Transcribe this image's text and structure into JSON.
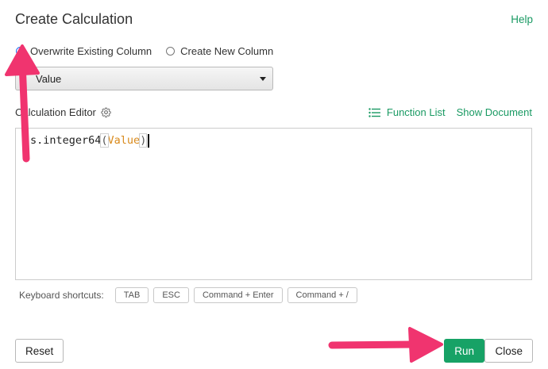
{
  "dialog": {
    "title": "Create Calculation",
    "help_label": "Help"
  },
  "mode": {
    "options": [
      {
        "label": "Overwrite Existing Column",
        "checked": true
      },
      {
        "label": "Create New Column",
        "checked": false
      }
    ]
  },
  "column_select": {
    "value": "Value"
  },
  "editor": {
    "label": "Calculation Editor",
    "function_list_label": "Function List",
    "show_document_label": "Show Document",
    "code_prefix": "s.integer64",
    "code_open": "(",
    "code_arg": "Value",
    "code_close": ")"
  },
  "shortcuts": {
    "label": "Keyboard shortcuts:",
    "keys": [
      "TAB",
      "ESC",
      "Command + Enter",
      "Command + /"
    ]
  },
  "footer": {
    "reset_label": "Reset",
    "run_label": "Run",
    "close_label": "Close"
  },
  "colors": {
    "accent_green": "#17a266",
    "link_green": "#1a9a63",
    "radio_blue": "#1d6ef2",
    "annotation_pink": "#f0346f"
  }
}
